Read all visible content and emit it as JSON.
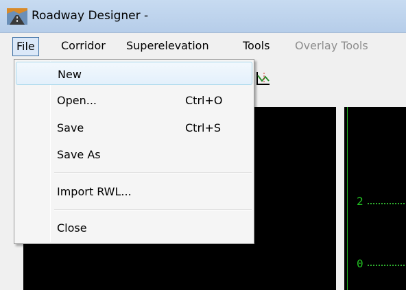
{
  "window": {
    "title": "Roadway Designer -"
  },
  "menubar": {
    "items": [
      {
        "label": "File",
        "active": true
      },
      {
        "label": "Corridor"
      },
      {
        "label": "Superelevation"
      },
      {
        "label": "Tools"
      },
      {
        "label": "Overlay Tools",
        "disabled": true
      }
    ]
  },
  "file_menu": {
    "items": [
      {
        "label": "New",
        "shortcut": ""
      },
      {
        "label": "Open...",
        "shortcut": "Ctrl+O"
      },
      {
        "label": "Save",
        "shortcut": "Ctrl+S"
      },
      {
        "label": "Save As",
        "shortcut": ""
      },
      {
        "label": "Import RWL...",
        "shortcut": ""
      },
      {
        "label": "Close",
        "shortcut": ""
      }
    ]
  },
  "view": {
    "axis_labels": [
      "2",
      "0"
    ]
  },
  "colors": {
    "titlebar": "#c7dbf1",
    "view_background": "#000000",
    "axis_green": "#22c122",
    "menu_highlight": "#dbe8f8"
  },
  "icons": {
    "app": "roadway-designer-icon",
    "toolbar": "profile-chart-icon"
  }
}
